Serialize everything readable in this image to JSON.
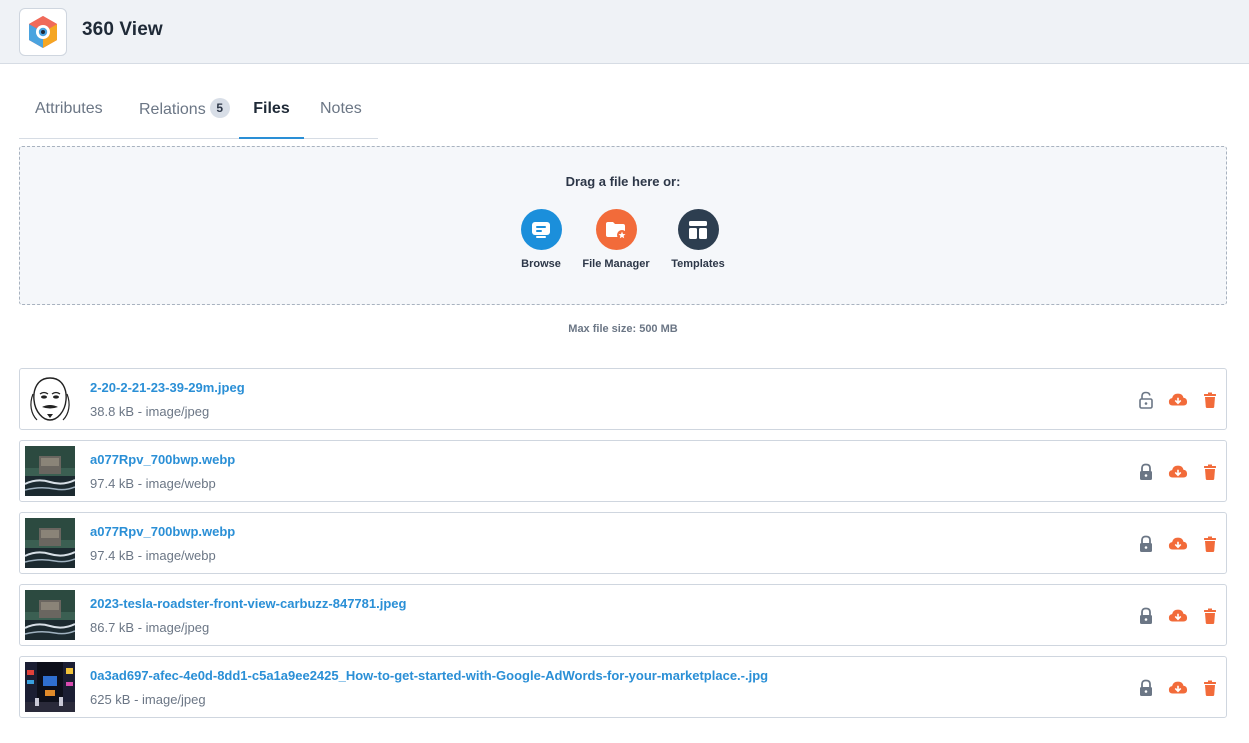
{
  "app": {
    "title": "360 View"
  },
  "tabs": [
    {
      "label": "Attributes",
      "active": false
    },
    {
      "label": "Relations",
      "badge": "5",
      "active": false
    },
    {
      "label": "Files",
      "active": true
    },
    {
      "label": "Notes",
      "active": false
    }
  ],
  "dropzone": {
    "prompt": "Drag a file here or:",
    "sources": [
      {
        "label": "Browse",
        "icon": "browse-icon",
        "color": "#1b8fdb"
      },
      {
        "label": "File Manager",
        "icon": "folder-star-icon",
        "color": "#f26b3a"
      },
      {
        "label": "Templates",
        "icon": "templates-icon",
        "color": "#2d3e50"
      }
    ]
  },
  "max_file_size": "Max file size: 500 MB",
  "files": [
    {
      "name": "2-20-2-21-23-39-29m.jpeg",
      "meta": "38.8 kB - image/jpeg",
      "thumb": "mask-sketch",
      "locked": false
    },
    {
      "name": "a077Rpv_700bwp.webp",
      "meta": "97.4 kB - image/webp",
      "thumb": "car-photo",
      "locked": true
    },
    {
      "name": "a077Rpv_700bwp.webp",
      "meta": "97.4 kB - image/webp",
      "thumb": "car-photo",
      "locked": true
    },
    {
      "name": "2023-tesla-roadster-front-view-carbuzz-847781.jpeg",
      "meta": "86.7 kB - image/jpeg",
      "thumb": "car-photo",
      "locked": true
    },
    {
      "name": "0a3ad697-afec-4e0d-8dd1-c5a1a9ee2425_How-to-get-started-with-Google-AdWords-for-your-marketplace.-.jpg",
      "meta": "625 kB - image/jpeg",
      "thumb": "city-night",
      "locked": true
    }
  ],
  "colors": {
    "link": "#2a8fd6",
    "action_orange": "#f26b3a",
    "lock_gray": "#6b7685"
  }
}
